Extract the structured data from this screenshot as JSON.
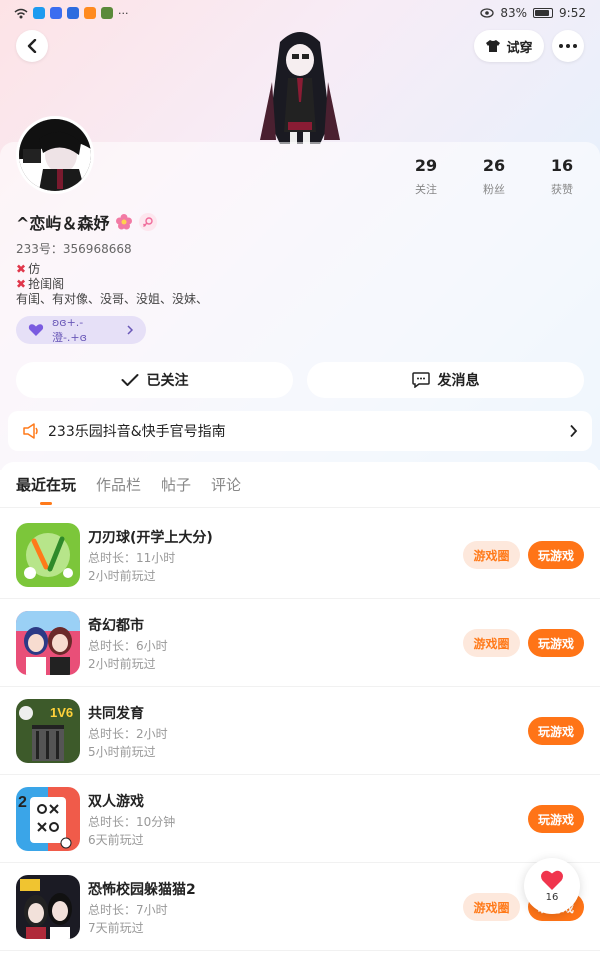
{
  "status_bar": {
    "battery": "83%",
    "time": "9:52"
  },
  "nav": {
    "try_on_label": "试穿"
  },
  "profile": {
    "username": "^恋屿＆森妤",
    "uid": "233号：356968668",
    "bio_lines": [
      "仿",
      "抢闺阁",
      "有闺、有对像、没哥、没姐、没妹、"
    ],
    "tag_label": "ʚɞ+.-澄-.+ɞ"
  },
  "stats": [
    {
      "value": "29",
      "label": "关注"
    },
    {
      "value": "26",
      "label": "粉丝"
    },
    {
      "value": "16",
      "label": "获赞"
    }
  ],
  "actions": {
    "follow_label": "已关注",
    "message_label": "发消息"
  },
  "notice": {
    "text": "233乐园抖音&快手官号指南"
  },
  "tabs": [
    {
      "label": "最近在玩",
      "active": true
    },
    {
      "label": "作品栏",
      "active": false
    },
    {
      "label": "帖子",
      "active": false
    },
    {
      "label": "评论",
      "active": false
    }
  ],
  "games": [
    {
      "title": "刀刃球(开学上大分)",
      "duration": "总时长：11小时",
      "last_played": "2小时前玩过",
      "has_circle": true,
      "icon": "knife-ball-icon"
    },
    {
      "title": "奇幻都市",
      "duration": "总时长：6小时",
      "last_played": "2小时前玩过",
      "has_circle": true,
      "icon": "fantasy-city-icon"
    },
    {
      "title": "共同发育",
      "duration": "总时长：2小时",
      "last_played": "5小时前玩过",
      "has_circle": false,
      "icon": "grow-together-icon"
    },
    {
      "title": "双人游戏",
      "duration": "总时长：10分钟",
      "last_played": "6天前玩过",
      "has_circle": false,
      "icon": "two-player-icon"
    },
    {
      "title": "恐怖校园躲猫猫2",
      "duration": "总时长：7小时",
      "last_played": "7天前玩过",
      "has_circle": true,
      "icon": "horror-school-icon"
    }
  ],
  "game_buttons": {
    "circle_label": "游戏圈",
    "play_label": "玩游戏"
  },
  "like_float": {
    "count": "16"
  },
  "colors": {
    "accent": "#ff7417",
    "accent_light": "#fde8dc",
    "tag_bg": "#e6e0f7",
    "heart": "#f0354d"
  }
}
